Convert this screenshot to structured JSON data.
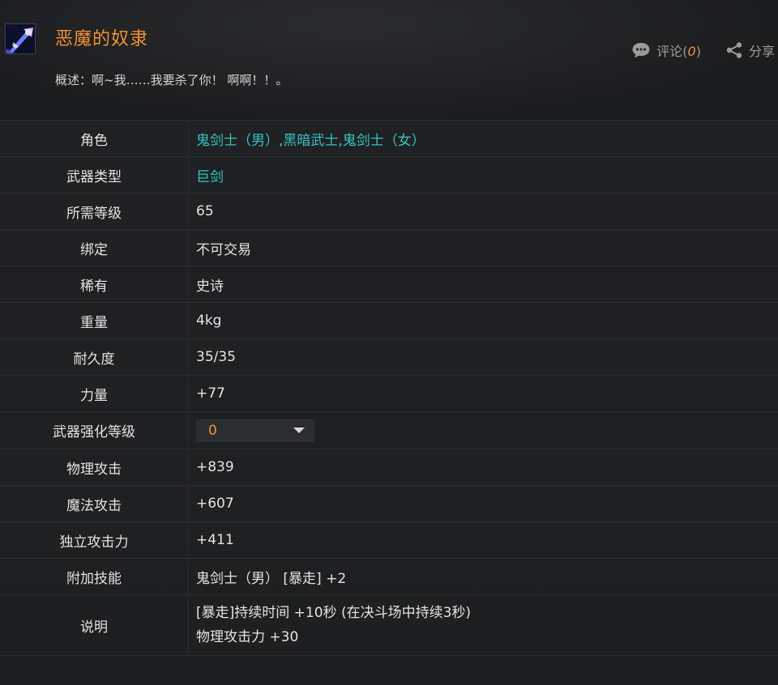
{
  "header": {
    "title": "恶魔的奴隶",
    "description": "概述：啊~我……我要杀了你！ 啊啊！！。",
    "comment_label": "评论(",
    "comment_count": "0",
    "comment_close": ")",
    "share_label": "分享",
    "icons": {
      "item": "sword-item-icon",
      "comment": "comment-bubble-icon",
      "share": "share-icon"
    },
    "colors": {
      "title": "#f0922e",
      "link": "#2fc4c4"
    }
  },
  "rows": [
    {
      "label": "角色",
      "value": "鬼剑士（男）,黑暗武士,鬼剑士（女）"
    },
    {
      "label": "武器类型",
      "value": "巨剑"
    },
    {
      "label": "所需等级",
      "value": "65"
    },
    {
      "label": "绑定",
      "value": "不可交易"
    },
    {
      "label": "稀有",
      "value": "史诗"
    },
    {
      "label": "重量",
      "value": "4kg"
    },
    {
      "label": "耐久度",
      "value": "35/35"
    },
    {
      "label": "力量",
      "value": "+77"
    },
    {
      "label": "武器强化等级",
      "value": "0"
    },
    {
      "label": "物理攻击",
      "value": "+839"
    },
    {
      "label": "魔法攻击",
      "value": "+607"
    },
    {
      "label": "独立攻击力",
      "value": "+411"
    },
    {
      "label": "附加技能",
      "value": "鬼剑士（男） [暴走] +2"
    },
    {
      "label": "说明",
      "lines": [
        "[暴走]持续时间 +10秒 (在决斗场中持续3秒)",
        "物理攻击力 +30"
      ]
    }
  ]
}
